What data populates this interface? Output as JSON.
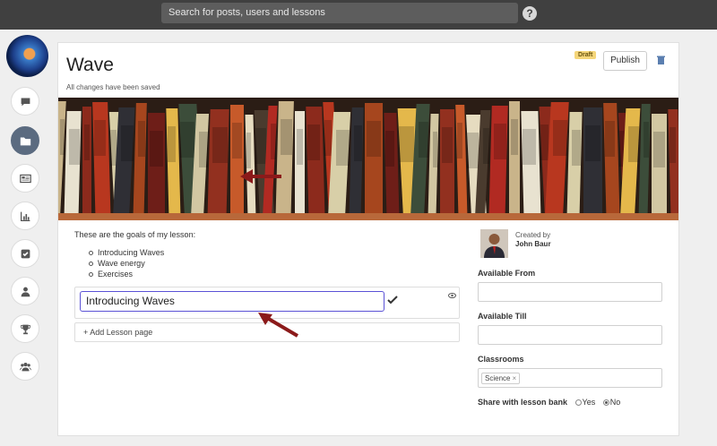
{
  "topbar": {
    "search_placeholder": "Search for posts, users and lessons",
    "help_icon": "question-circle-icon",
    "help_glyph": "?"
  },
  "sidebar": {
    "items": [
      {
        "name": "comments",
        "icon": "speech-bubble-icon"
      },
      {
        "name": "lessons",
        "icon": "folder-icon",
        "active": true
      },
      {
        "name": "newsfeed",
        "icon": "newspaper-icon"
      },
      {
        "name": "analytics",
        "icon": "bar-chart-icon"
      },
      {
        "name": "assignments",
        "icon": "checkbox-icon"
      },
      {
        "name": "profile",
        "icon": "person-icon"
      },
      {
        "name": "achievements",
        "icon": "trophy-icon"
      },
      {
        "name": "groups",
        "icon": "group-icon"
      }
    ]
  },
  "lesson": {
    "title": "Wave",
    "save_status": "All changes have been saved",
    "draft_badge": "Draft",
    "publish_label": "Publish",
    "goals_intro": "These are the goals of my lesson:",
    "goals": [
      "Introducing Waves",
      "Wave energy",
      "Exercises"
    ],
    "page_title_value": "Introducing Waves",
    "add_page_label": "+ Add Lesson page"
  },
  "details": {
    "created_by_label": "Created by",
    "author": "John Baur",
    "available_from_label": "Available From",
    "available_till_label": "Available Till",
    "classrooms_label": "Classrooms",
    "classroom_tag": "Science",
    "classroom_tag_remove": "×",
    "share_label": "Share with lesson bank",
    "share_yes": "Yes",
    "share_no": "No",
    "share_selected": "No"
  },
  "colors": {
    "topbar": "#404040",
    "active_sidebar": "#5b6b80",
    "input_focus": "#5b52d6",
    "draft_badge": "#f5d67a",
    "annotation_arrow": "#8b1a1a"
  }
}
